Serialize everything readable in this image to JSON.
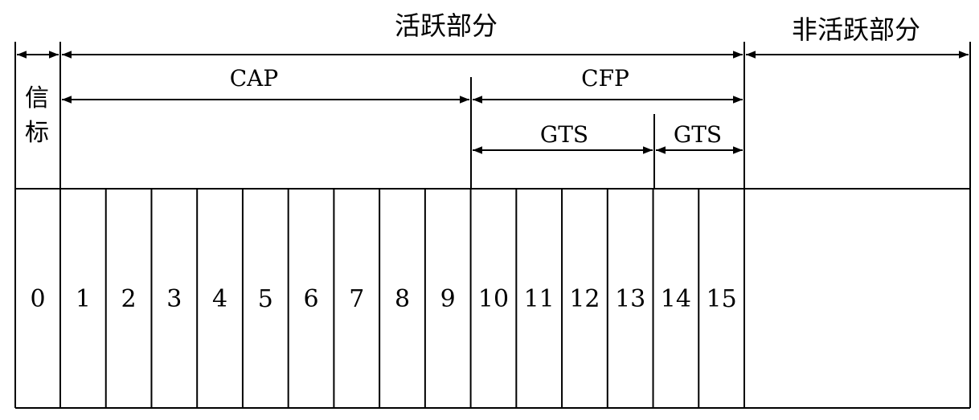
{
  "labels": {
    "active": "活跃部分",
    "inactive": "非活跃部分",
    "beacon_1": "信",
    "beacon_2": "标",
    "cap": "CAP",
    "cfp": "CFP",
    "gts_1": "GTS",
    "gts_2": "GTS"
  },
  "slots": [
    "0",
    "1",
    "2",
    "3",
    "4",
    "5",
    "6",
    "7",
    "8",
    "9",
    "10",
    "11",
    "12",
    "13",
    "14",
    "15"
  ]
}
